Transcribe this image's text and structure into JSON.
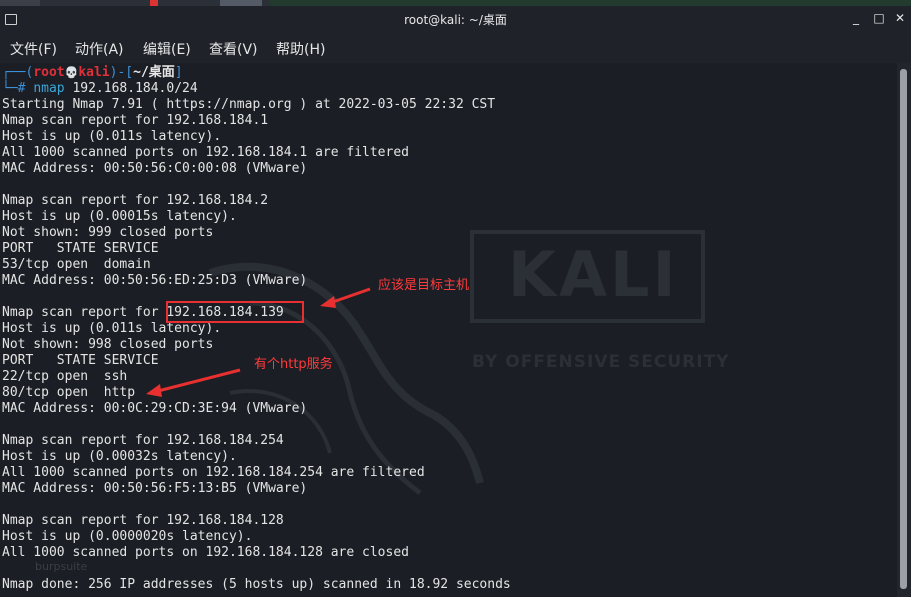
{
  "window": {
    "title": "root@kali: ~/桌面"
  },
  "menu": [
    "文件(F)",
    "动作(A)",
    "编辑(E)",
    "查看(V)",
    "帮助(H)"
  ],
  "prompt": {
    "line1_open": "┌──(",
    "user": "root",
    "skull": "💀",
    "host": "kali",
    "line1_mid": ")-[",
    "path": "~/桌面",
    "line1_close": "]",
    "line2_prefix": "└─",
    "hash": "#",
    "command": "nmap",
    "args": " 192.168.184.0/24"
  },
  "output_lines": [
    "Starting Nmap 7.91 ( https://nmap.org ) at 2022-03-05 22:32 CST",
    "Nmap scan report for 192.168.184.1",
    "Host is up (0.011s latency).",
    "All 1000 scanned ports on 192.168.184.1 are filtered",
    "MAC Address: 00:50:56:C0:00:08 (VMware)",
    "",
    "Nmap scan report for 192.168.184.2",
    "Host is up (0.00015s latency).",
    "Not shown: 999 closed ports",
    "PORT   STATE SERVICE",
    "53/tcp open  domain",
    "MAC Address: 00:50:56:ED:25:D3 (VMware)",
    "",
    "Nmap scan report for 192.168.184.139",
    "Host is up (0.011s latency).",
    "Not shown: 998 closed ports",
    "PORT   STATE SERVICE",
    "22/tcp open  ssh",
    "80/tcp open  http",
    "MAC Address: 00:0C:29:CD:3E:94 (VMware)",
    "",
    "Nmap scan report for 192.168.184.254",
    "Host is up (0.00032s latency).",
    "All 1000 scanned ports on 192.168.184.254 are filtered",
    "MAC Address: 00:50:56:F5:13:B5 (VMware)",
    "",
    "Nmap scan report for 192.168.184.128",
    "Host is up (0.0000020s latency).",
    "All 1000 scanned ports on 192.168.184.128 are closed",
    "",
    "Nmap done: 256 IP addresses (5 hosts up) scanned in 18.92 seconds"
  ],
  "annotations": {
    "target_note": "应该是目标主机",
    "http_note": "有个http服务"
  },
  "background": {
    "logo_text": "KALI",
    "logo_subtext": "BY OFFENSIVE SECURITY",
    "faded_text": "burpsuite"
  },
  "colors": {
    "annotation": "#e83030",
    "prompt_user": "#e0303a",
    "prompt_frame": "#3d8fd6"
  }
}
